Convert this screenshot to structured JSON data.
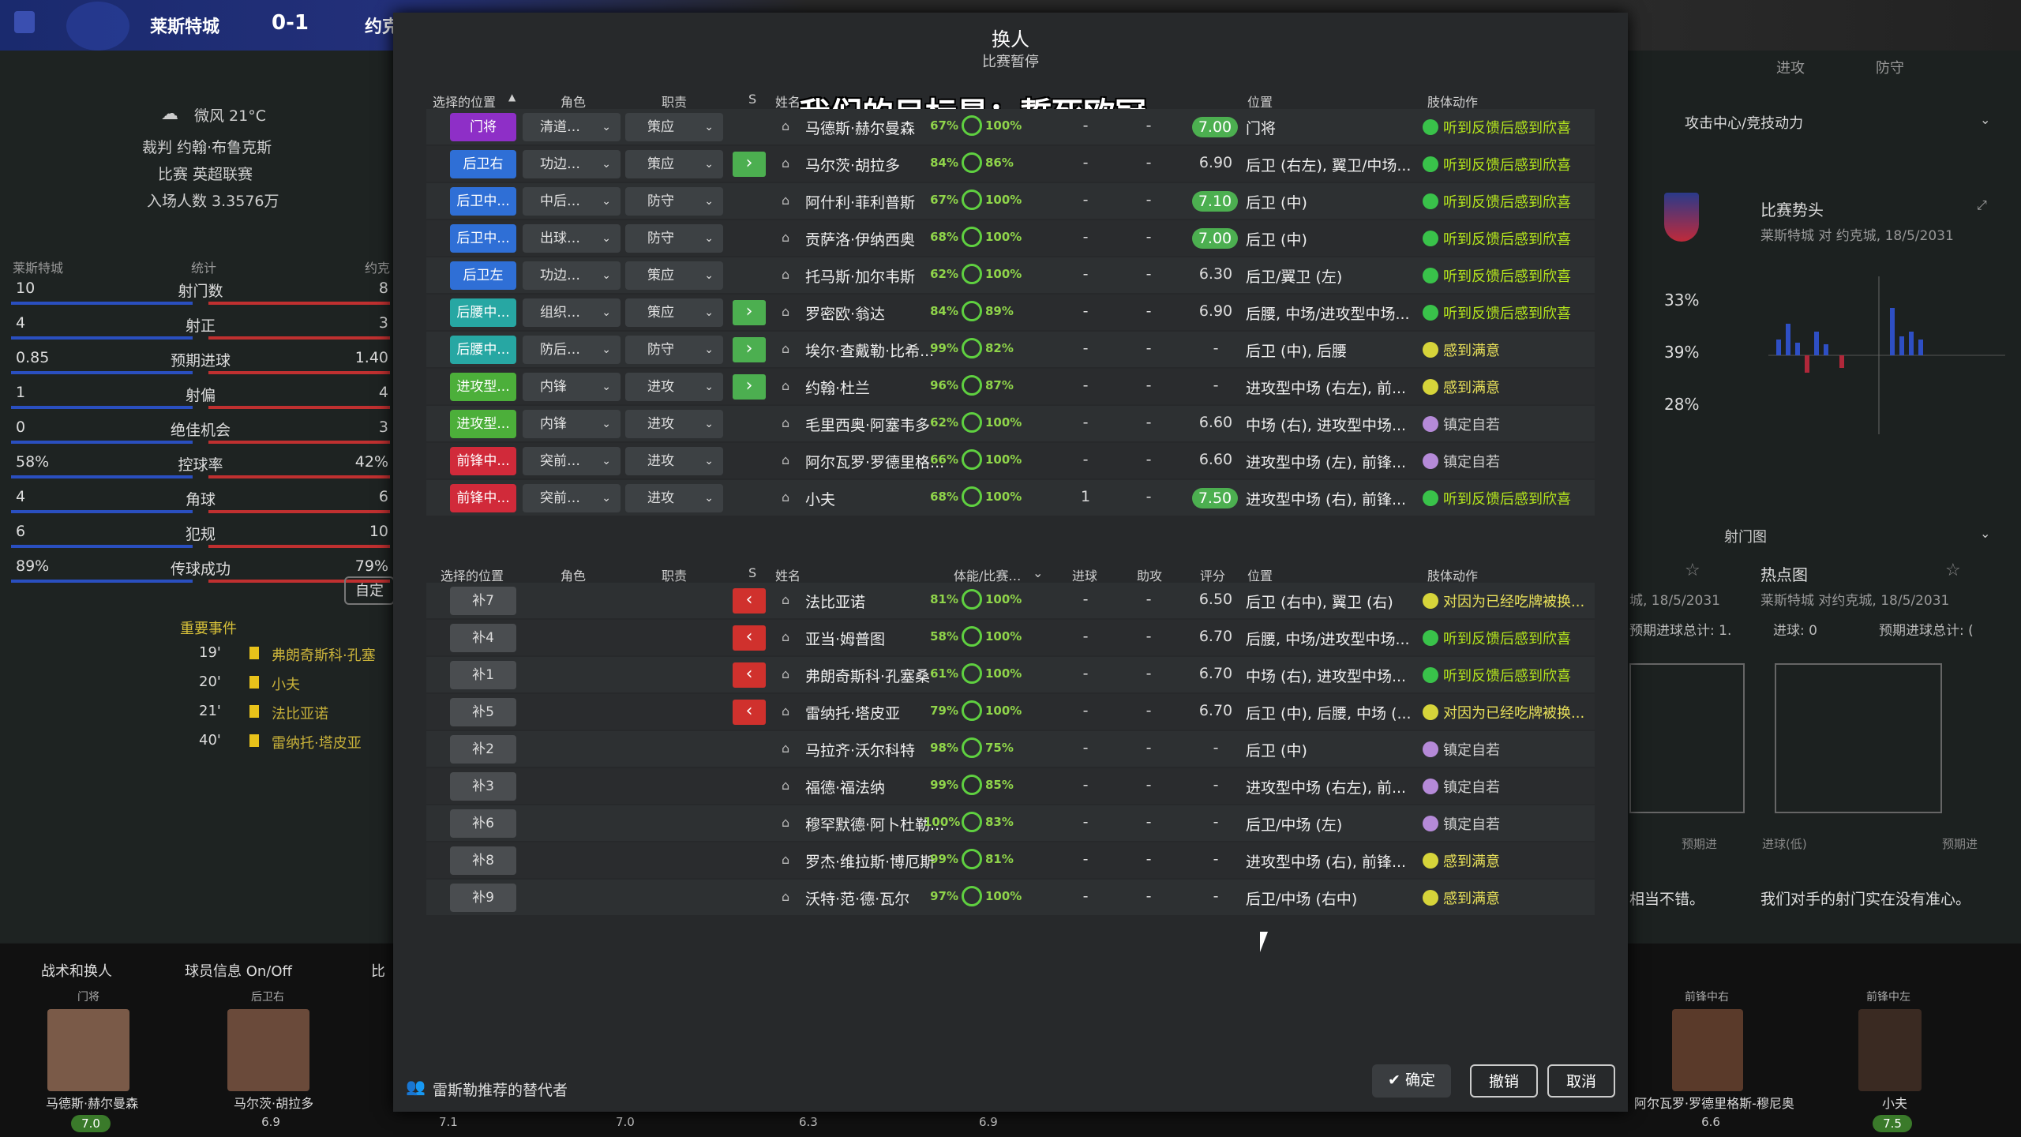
{
  "topbar": {
    "home_team": "莱斯特城",
    "score": "0-1",
    "away_team_short": "约克"
  },
  "left": {
    "weather": "微风 21°C",
    "referee": "裁判 约翰·布鲁克斯",
    "competition": "比赛 英超联赛",
    "attendance": "入场人数 3.3576万",
    "header_home": "莱斯特城",
    "header_stats": "统计",
    "header_away": "约克",
    "stats": [
      {
        "home": "10",
        "label": "射门数",
        "away": "8"
      },
      {
        "home": "4",
        "label": "射正",
        "away": "3"
      },
      {
        "home": "0.85",
        "label": "预期进球",
        "away": "1.40"
      },
      {
        "home": "1",
        "label": "射偏",
        "away": "4"
      },
      {
        "home": "0",
        "label": "绝佳机会",
        "away": "3"
      },
      {
        "home": "58%",
        "label": "控球率",
        "away": "42%"
      },
      {
        "home": "4",
        "label": "角球",
        "away": "6"
      },
      {
        "home": "6",
        "label": "犯规",
        "away": "10"
      },
      {
        "home": "89%",
        "label": "传球成功",
        "away": "79%"
      }
    ],
    "custom_btn": "自定",
    "events_title": "重要事件",
    "events": [
      {
        "min": "19'",
        "text": "弗朗奇斯科·孔塞"
      },
      {
        "min": "20'",
        "text": "小夫"
      },
      {
        "min": "21'",
        "text": "法比亚诺"
      },
      {
        "min": "40'",
        "text": "雷纳托·塔皮亚"
      }
    ]
  },
  "right": {
    "dropdown": "攻击中心/竞技动力",
    "match_trend": "比赛势头",
    "match_sub": "莱斯特城 对 约克城, 18/5/2031",
    "pcts": [
      "33%",
      "39%",
      "28%"
    ],
    "shot_map": "射门图",
    "heatmap": "热点图",
    "heat_sub": "莱斯特城 对约克城, 18/5/2031",
    "left_sub": "城, 18/5/2031",
    "xg_left": "预期进球总计: 1.",
    "goals_right": "进球: 0",
    "xg_right": "预期进球总计: (",
    "xg_label_l": "预期进",
    "goals_low": "进球(低)",
    "xg_label_r": "预期进",
    "comment_left": "相当不错。",
    "comment_right": "我们对手的射门实在没有准心。",
    "top_tabs": [
      "进攻",
      "防守"
    ]
  },
  "bottom": {
    "tactics": "战术和换人",
    "player_info": "球员信息 On/Off",
    "bi": "比",
    "slots_left": [
      "门将",
      "后卫右"
    ],
    "names_left": [
      "马德斯·赫尔曼森",
      "马尔茨·胡拉多"
    ],
    "ratings_left": [
      "7.0",
      "6.9"
    ],
    "slots_right": [
      "前锋中右",
      "前锋中左"
    ],
    "names_right": [
      "阿尔瓦罗·罗德里格斯-穆尼奥",
      "小夫"
    ],
    "ratings_right": [
      "6.6",
      "7.5"
    ],
    "misc_ratings": [
      "7.1",
      "7.0",
      "6.3",
      "6.9"
    ]
  },
  "modal": {
    "title": "换人",
    "subtitle": "比赛暂停",
    "overlay_text": "我们的目标是：誓死欧冠",
    "headers": {
      "pos": "选择的位置",
      "role": "角色",
      "duty": "职责",
      "s": "S",
      "name": "姓名",
      "cond": "体能/比赛…",
      "goals": "进球",
      "assists": "助攻",
      "rating": "评分",
      "position": "位置",
      "body": "肢体动作"
    },
    "starters": [
      {
        "pos": "门将",
        "color": "#8e2fc7",
        "role": "清道…",
        "duty": "策应",
        "sub": "",
        "name": "马德斯·赫尔曼森",
        "cond": "67%",
        "sharp": "100%",
        "goals": "-",
        "assists": "-",
        "rating": "7.00",
        "hi": true,
        "position": "门将",
        "body": "听到反馈后感到欣喜",
        "mood": "green"
      },
      {
        "pos": "后卫右",
        "color": "#2f6fd6",
        "role": "功边…",
        "duty": "策应",
        "sub": "in",
        "name": "马尔茨·胡拉多",
        "cond": "84%",
        "sharp": "86%",
        "goals": "-",
        "assists": "-",
        "rating": "6.90",
        "hi": false,
        "position": "后卫 (右左), 翼卫/中场...",
        "body": "听到反馈后感到欣喜",
        "mood": "green"
      },
      {
        "pos": "后卫中...",
        "color": "#2f6fd6",
        "role": "中后…",
        "duty": "防守",
        "sub": "",
        "name": "阿什利·菲利普斯",
        "cond": "67%",
        "sharp": "100%",
        "goals": "-",
        "assists": "-",
        "rating": "7.10",
        "hi": true,
        "position": "后卫 (中)",
        "body": "听到反馈后感到欣喜",
        "mood": "green"
      },
      {
        "pos": "后卫中...",
        "color": "#2f6fd6",
        "role": "出球…",
        "duty": "防守",
        "sub": "",
        "name": "贡萨洛·伊纳西奥",
        "cond": "68%",
        "sharp": "100%",
        "goals": "-",
        "assists": "-",
        "rating": "7.00",
        "hi": true,
        "position": "后卫 (中)",
        "body": "听到反馈后感到欣喜",
        "mood": "green"
      },
      {
        "pos": "后卫左",
        "color": "#2f6fd6",
        "role": "功边…",
        "duty": "策应",
        "sub": "",
        "name": "托马斯·加尔韦斯",
        "cond": "62%",
        "sharp": "100%",
        "goals": "-",
        "assists": "-",
        "rating": "6.30",
        "hi": false,
        "position": "后卫/翼卫 (左)",
        "body": "听到反馈后感到欣喜",
        "mood": "green"
      },
      {
        "pos": "后腰中...",
        "color": "#27a7a3",
        "role": "组织…",
        "duty": "策应",
        "sub": "in",
        "name": "罗密欧·翁达",
        "cond": "84%",
        "sharp": "89%",
        "goals": "-",
        "assists": "-",
        "rating": "6.90",
        "hi": false,
        "position": "后腰, 中场/进攻型中场...",
        "body": "听到反馈后感到欣喜",
        "mood": "green"
      },
      {
        "pos": "后腰中...",
        "color": "#27a7a3",
        "role": "防后…",
        "duty": "防守",
        "sub": "in",
        "name": "埃尔·查戴勒·比希...",
        "cond": "99%",
        "sharp": "82%",
        "goals": "-",
        "assists": "-",
        "rating": "-",
        "hi": false,
        "position": "后卫 (中), 后腰",
        "body": "感到满意",
        "mood": "yellow"
      },
      {
        "pos": "进攻型...",
        "color": "#4caf3a",
        "role": "内锋",
        "duty": "进攻",
        "sub": "in",
        "name": "约翰·杜兰",
        "cond": "96%",
        "sharp": "87%",
        "goals": "-",
        "assists": "-",
        "rating": "-",
        "hi": false,
        "position": "进攻型中场 (右左), 前...",
        "body": "感到满意",
        "mood": "yellow"
      },
      {
        "pos": "进攻型...",
        "color": "#4caf3a",
        "role": "内锋",
        "duty": "进攻",
        "sub": "",
        "name": "毛里西奥·阿塞韦多",
        "cond": "62%",
        "sharp": "100%",
        "goals": "-",
        "assists": "-",
        "rating": "6.60",
        "hi": false,
        "position": "中场 (右), 进攻型中场...",
        "body": "镇定自若",
        "mood": "purple"
      },
      {
        "pos": "前锋中...",
        "color": "#d12a3a",
        "role": "突前…",
        "duty": "进攻",
        "sub": "",
        "name": "阿尔瓦罗·罗德里格...",
        "cond": "66%",
        "sharp": "100%",
        "goals": "-",
        "assists": "-",
        "rating": "6.60",
        "hi": false,
        "position": "进攻型中场 (左), 前锋...",
        "body": "镇定自若",
        "mood": "purple"
      },
      {
        "pos": "前锋中...",
        "color": "#d12a3a",
        "role": "突前…",
        "duty": "进攻",
        "sub": "",
        "name": "小夫",
        "cond": "68%",
        "sharp": "100%",
        "goals": "1",
        "assists": "-",
        "rating": "7.50",
        "hi": true,
        "position": "进攻型中场 (右), 前锋...",
        "body": "听到反馈后感到欣喜",
        "mood": "green"
      }
    ],
    "subs": [
      {
        "pos": "补7",
        "sub": "out",
        "name": "法比亚诺",
        "cond": "81%",
        "sharp": "100%",
        "goals": "-",
        "assists": "-",
        "rating": "6.50",
        "position": "后卫 (右中), 翼卫 (右)",
        "body": "对因为已经吃牌被换...",
        "mood": "yellow"
      },
      {
        "pos": "补4",
        "sub": "out",
        "name": "亚当·姆普图",
        "cond": "58%",
        "sharp": "100%",
        "goals": "-",
        "assists": "-",
        "rating": "6.70",
        "position": "后腰, 中场/进攻型中场...",
        "body": "听到反馈后感到欣喜",
        "mood": "green"
      },
      {
        "pos": "补1",
        "sub": "out",
        "name": "弗朗奇斯科·孔塞桑",
        "cond": "61%",
        "sharp": "100%",
        "goals": "-",
        "assists": "-",
        "rating": "6.70",
        "position": "中场 (右), 进攻型中场...",
        "body": "听到反馈后感到欣喜",
        "mood": "green"
      },
      {
        "pos": "补5",
        "sub": "out",
        "name": "雷纳托·塔皮亚",
        "cond": "79%",
        "sharp": "100%",
        "goals": "-",
        "assists": "-",
        "rating": "6.70",
        "position": "后卫 (中), 后腰, 中场 (...",
        "body": "对因为已经吃牌被换...",
        "mood": "yellow"
      },
      {
        "pos": "补2",
        "sub": "",
        "name": "马拉齐·沃尔科特",
        "cond": "98%",
        "sharp": "75%",
        "goals": "-",
        "assists": "-",
        "rating": "-",
        "position": "后卫 (中)",
        "body": "镇定自若",
        "mood": "purple"
      },
      {
        "pos": "补3",
        "sub": "",
        "name": "福德·福法纳",
        "cond": "99%",
        "sharp": "85%",
        "goals": "-",
        "assists": "-",
        "rating": "-",
        "position": "进攻型中场 (右左), 前...",
        "body": "镇定自若",
        "mood": "purple"
      },
      {
        "pos": "补6",
        "sub": "",
        "name": "穆罕默德·阿卜杜勒...",
        "cond": "100%",
        "sharp": "83%",
        "goals": "-",
        "assists": "-",
        "rating": "-",
        "position": "后卫/中场 (左)",
        "body": "镇定自若",
        "mood": "purple"
      },
      {
        "pos": "补8",
        "sub": "",
        "name": "罗杰·维拉斯·博厄斯",
        "cond": "99%",
        "sharp": "81%",
        "goals": "-",
        "assists": "-",
        "rating": "-",
        "position": "进攻型中场 (右), 前锋...",
        "body": "感到满意",
        "mood": "yellow"
      },
      {
        "pos": "补9",
        "sub": "",
        "name": "沃特·范·德·瓦尔",
        "cond": "97%",
        "sharp": "100%",
        "goals": "-",
        "assists": "-",
        "rating": "-",
        "position": "后卫/中场 (右中)",
        "body": "感到满意",
        "mood": "yellow"
      }
    ],
    "recommend": "雷斯勒推荐的替代者",
    "btn_confirm": "确定",
    "btn_undo": "撤销",
    "btn_cancel": "取消"
  }
}
